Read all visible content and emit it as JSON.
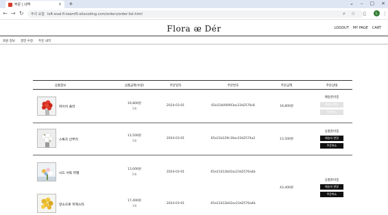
{
  "browser": {
    "tab_title": "주문 | 내역",
    "tab_close": "×",
    "new_tab": "+",
    "window_controls": [
      "⌄",
      "–",
      "▢",
      "×"
    ],
    "security_label": "주의 요함",
    "url": "loft-eval-fi-teamf0.elixcoding.com/orders/order-list.html",
    "avatar_letter": "L"
  },
  "site": {
    "logo": "Flora ᴂ Dér",
    "header_links": [
      "LOGOUT",
      "MY PAGE",
      "CART"
    ],
    "subnav": [
      "회원 정보",
      "결한 수정",
      "주문 내역"
    ]
  },
  "table": {
    "headers": [
      "상품정보",
      "상품금액(수량)",
      "주문일자",
      "주문번호",
      "주문금액",
      "주문상태"
    ],
    "orders": [
      {
        "name": "파이어 플라",
        "price": "19,800원",
        "qty": "1개",
        "date": "2024-03-01",
        "order_no": "65e21b090f03ac23d2576c8",
        "total": "19,800원",
        "status": "배송준비중",
        "buttons": [
          "배송지 변경",
          "주문취소"
        ],
        "buttons_disabled": true
      },
      {
        "name": "스톡즈 안부리",
        "price": "13,500원",
        "qty": "1개",
        "date": "2024-03-01",
        "order_no": "65e21b129c30ac23d2574a2",
        "total": "13,500원",
        "status": "상품준비중",
        "buttons": [
          "배송지 변경",
          "주문취소"
        ],
        "buttons_disabled": false
      },
      {
        "items": [
          {
            "name": "시드 서독 파헬",
            "price": "13,000원",
            "qty": "2개",
            "date": "2024-03-01",
            "order_no": "65e21412b02ac23d2576a4b"
          },
          {
            "name": "양소으로 피헤스타",
            "price": "17,400원",
            "qty": "1개",
            "date": "2024-03-01",
            "order_no": "65e21412b02ac23d2576a4b"
          }
        ],
        "total": "43,400원",
        "status": "상품준비중",
        "buttons": [
          "배송지 변경",
          "주문취소"
        ],
        "buttons_disabled": false
      }
    ]
  }
}
